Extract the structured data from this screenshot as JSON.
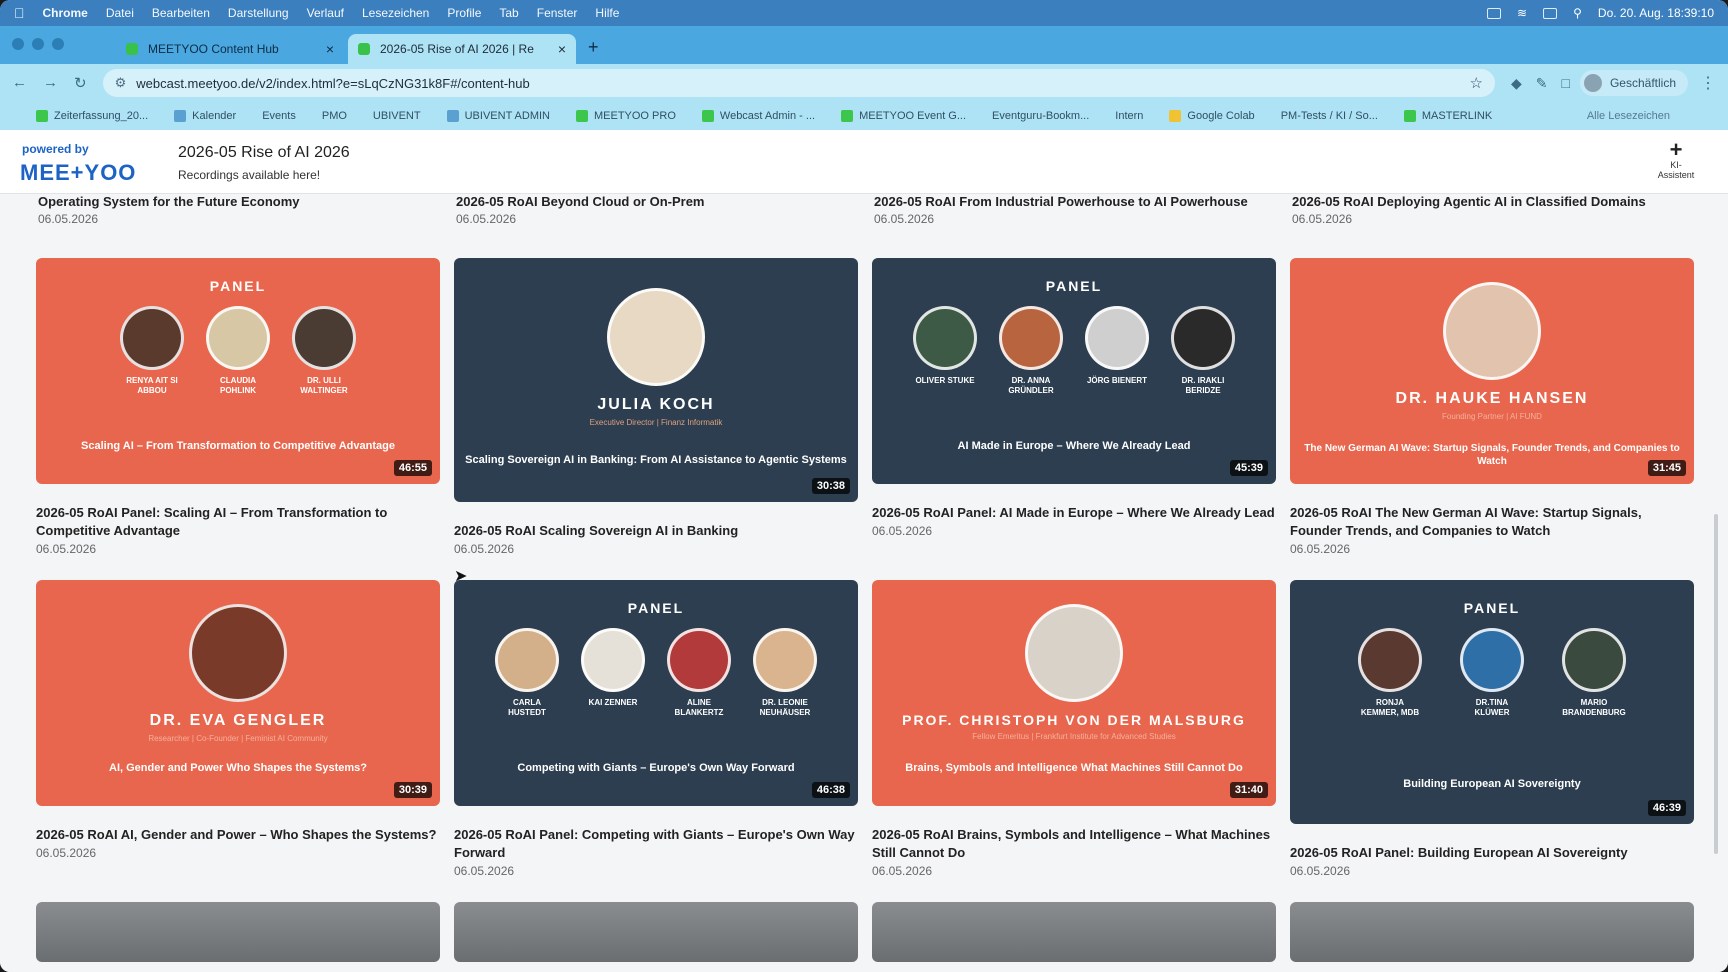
{
  "menubar": {
    "app": "Chrome",
    "items": [
      "Datei",
      "Bearbeiten",
      "Darstellung",
      "Verlauf",
      "Lesezeichen",
      "Profile",
      "Tab",
      "Fenster",
      "Hilfe"
    ],
    "clock": "Do. 20. Aug. 18:39:10"
  },
  "tabs": [
    {
      "title": "MEETYOO Content Hub"
    },
    {
      "title": "2026-05 Rise of AI 2026 | Re"
    }
  ],
  "address": {
    "url": "webcast.meetyoo.de/v2/index.html?e=sLqCzNG31k8F#/content-hub",
    "profile": "Geschäftlich"
  },
  "bookmarks": [
    "Zeiterfassung_20...",
    "Kalender",
    "Events",
    "PMO",
    "UBIVENT",
    "UBIVENT ADMIN",
    "MEETYOO PRO",
    "Webcast Admin - ...",
    "MEETYOO Event G...",
    "Eventguru-Bookm...",
    "Intern",
    "Google Colab",
    "PM-Tests / KI / So...",
    "MASTERLINK",
    "Alle Lesezeichen"
  ],
  "header": {
    "powered": "powered by",
    "brand": "MEE+YOO",
    "title": "2026-05 Rise of AI 2026",
    "subtitle": "Recordings available here!",
    "assistant_label": "KI-Assistent"
  },
  "top_row": [
    {
      "title": "Operating System for the Future Economy",
      "date": "06.05.2026"
    },
    {
      "title": "2026-05 RoAI Beyond Cloud or On-Prem",
      "date": "06.05.2026"
    },
    {
      "title": "2026-05 RoAI From Industrial Powerhouse to AI Powerhouse",
      "date": "06.05.2026"
    },
    {
      "title": "2026-05 RoAI Deploying Agentic AI in Classified Domains",
      "date": "06.05.2026"
    }
  ],
  "cards": [
    {
      "title": "2026-05 RoAI Panel: Scaling AI – From Transformation to Competitive Advantage",
      "date": "06.05.2026",
      "duration": "46:55",
      "badge": "PANEL",
      "names": [
        "RENYA AIT SI ABBOU",
        "CLAUDIA POHLINK",
        "DR. ULLI WALTINGER"
      ],
      "topic": "Scaling AI – From Transformation to Competitive Advantage"
    },
    {
      "title": "2026-05 RoAI Scaling Sovereign AI in Banking",
      "date": "06.05.2026",
      "duration": "30:38",
      "speaker": "JULIA KOCH",
      "role": "Executive Director | Finanz Informatik",
      "topic": "Scaling Sovereign AI in Banking: From AI Assistance to Agentic Systems"
    },
    {
      "title": "2026-05 RoAI Panel: AI Made in Europe – Where We Already Lead",
      "date": "06.05.2026",
      "duration": "45:39",
      "badge": "PANEL",
      "names": [
        "OLIVER STUKE",
        "DR. ANNA GRÜNDLER",
        "JÖRG BIENERT",
        "DR. IRAKLI BERIDZE"
      ],
      "topic": "AI Made in Europe – Where We Already Lead"
    },
    {
      "title": "2026-05 RoAI The New German AI Wave: Startup Signals, Founder Trends, and Companies to Watch",
      "date": "06.05.2026",
      "duration": "31:45",
      "speaker": "DR. HAUKE HANSEN",
      "role": "Founding Partner | AI FUND",
      "topic": "The New German AI Wave: Startup Signals, Founder Trends, and Companies to Watch"
    },
    {
      "title": "2026-05 RoAI AI, Gender and Power – Who Shapes the Systems?",
      "date": "06.05.2026",
      "duration": "30:39",
      "speaker": "DR. EVA GENGLER",
      "role": "Researcher | Co-Founder | Feminist AI Community",
      "topic": "AI, Gender and Power Who Shapes the Systems?"
    },
    {
      "title": "2026-05 RoAI Panel: Competing with Giants – Europe's Own Way Forward",
      "date": "06.05.2026",
      "duration": "46:38",
      "badge": "PANEL",
      "names": [
        "CARLA HUSTEDT",
        "KAI ZENNER",
        "ALINE BLANKERTZ",
        "DR. LEONIE NEUHÄUSER"
      ],
      "topic": "Competing with Giants – Europe's Own Way Forward"
    },
    {
      "title": "2026-05 RoAI Brains, Symbols and Intelligence – What Machines Still Cannot Do",
      "date": "06.05.2026",
      "duration": "31:40",
      "speaker": "PROF. CHRISTOPH VON DER MALSBURG",
      "role": "Fellow Emeritus | Frankfurt Institute for Advanced Studies",
      "topic": "Brains, Symbols and Intelligence What Machines Still Cannot Do"
    },
    {
      "title": "2026-05 RoAI Panel: Building European AI Sovereignty",
      "date": "06.05.2026",
      "duration": "46:39",
      "badge": "PANEL",
      "names": [
        "RONJA KEMMER, MDB",
        "DR.TINA KLÜWER",
        "MARIO BRANDENBURG"
      ],
      "topic": "Building European AI Sovereignty"
    }
  ],
  "colors": {
    "menubar": "#3b7fbf",
    "tabstrip": "#4aa7df",
    "toolbar": "#aee3f5",
    "coral": "#e8664d",
    "navy": "#2c3e50",
    "brand": "#1d63c6"
  }
}
